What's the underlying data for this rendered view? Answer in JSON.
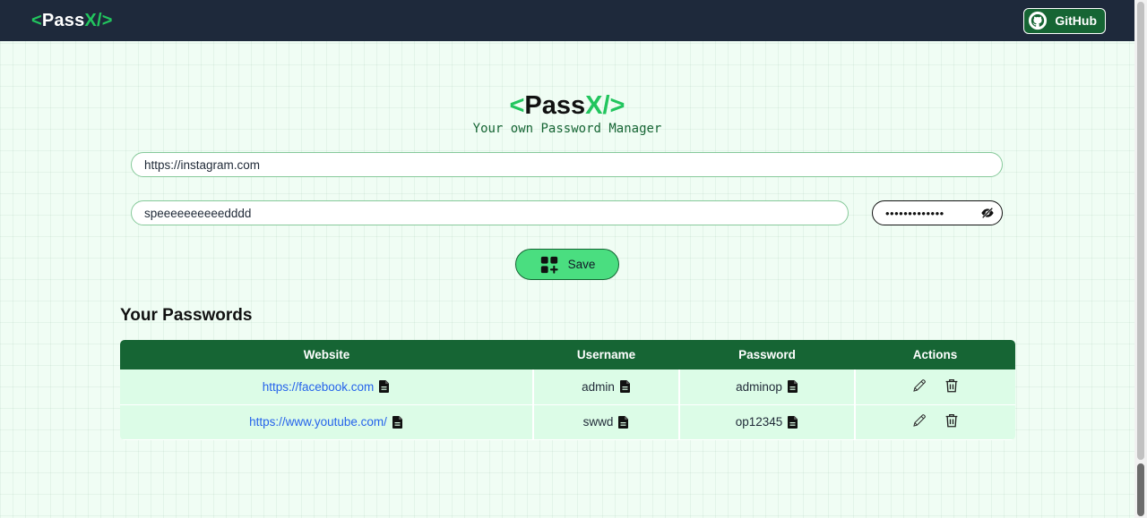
{
  "nav": {
    "logo_open": "<",
    "logo_main": "Pass",
    "logo_accent": "X/>",
    "github_label": "GitHub"
  },
  "hero": {
    "logo_open": "<",
    "logo_main": "Pass",
    "logo_accent": "X/>",
    "tagline": "Your own Password Manager"
  },
  "form": {
    "url_value": "https://instagram.com",
    "username_value": "speeeeeeeeeedddd",
    "password_masked": "•••••••••••••",
    "save_label": "Save"
  },
  "passwords": {
    "title": "Your Passwords",
    "columns": [
      "Website",
      "Username",
      "Password",
      "Actions"
    ],
    "rows": [
      {
        "website": "https://facebook.com",
        "username": "admin",
        "password": "adminop"
      },
      {
        "website": "https://www.youtube.com/",
        "username": "swwd",
        "password": "op12345"
      }
    ]
  },
  "colors": {
    "navbar": "#1e293b",
    "accent": "#22c55e",
    "table_header": "#166534",
    "row_bg": "#dcfce7",
    "save_button": "#4ade80"
  },
  "icons": [
    "github-icon",
    "eye-off-icon",
    "add-grid-icon",
    "copy-icon",
    "edit-icon",
    "trash-icon"
  ]
}
